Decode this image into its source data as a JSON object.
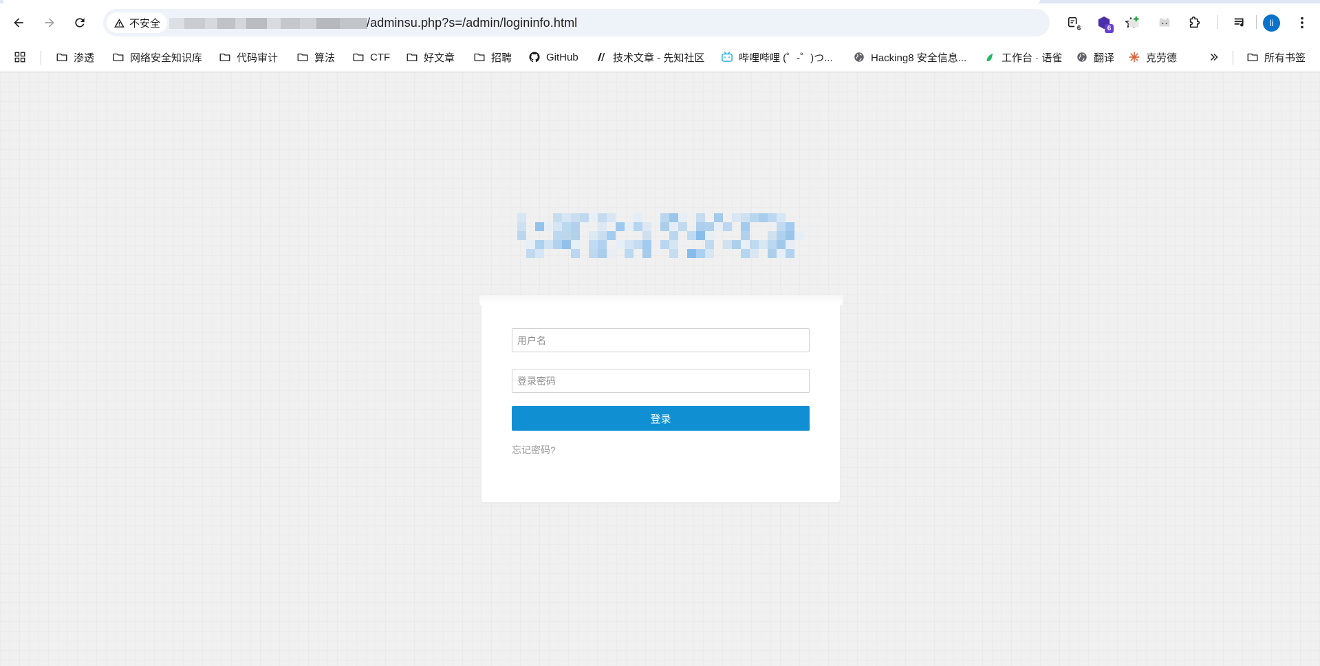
{
  "browser": {
    "security_label": "不安全",
    "url_visible": "/adminsu.php?s=/admin/logininfo.html",
    "extension_badges": [
      "6",
      "6"
    ],
    "profile_initial": "li",
    "accent_color": "#0b72c9"
  },
  "bookmarks": [
    {
      "label": "渗透",
      "icon": "folder-icon"
    },
    {
      "label": "网络安全知识库",
      "icon": "folder-icon"
    },
    {
      "label": "代码审计",
      "icon": "folder-icon"
    },
    {
      "label": "算法",
      "icon": "folder-icon"
    },
    {
      "label": "CTF",
      "icon": "folder-icon"
    },
    {
      "label": "好文章",
      "icon": "folder-icon"
    },
    {
      "label": "招聘",
      "icon": "folder-icon"
    },
    {
      "label": "GitHub",
      "icon": "github-icon"
    },
    {
      "label": "技术文章 - 先知社区",
      "icon": "xianzhi-icon"
    },
    {
      "label": "哔哩哔哩 (゜-゜)つ...",
      "icon": "bilibili-icon"
    },
    {
      "label": "Hacking8 安全信息...",
      "icon": "globe-icon"
    },
    {
      "label": "工作台 · 语雀",
      "icon": "yuque-icon"
    },
    {
      "label": "翻译",
      "icon": "globe-icon"
    },
    {
      "label": "克劳德",
      "icon": "claude-icon"
    }
  ],
  "all_bookmarks_label": "所有书签",
  "login": {
    "username_placeholder": "用户名",
    "password_placeholder": "登录密码",
    "submit_label": "登录",
    "forgot_label": "忘记密码?",
    "button_color": "#1090d2"
  }
}
